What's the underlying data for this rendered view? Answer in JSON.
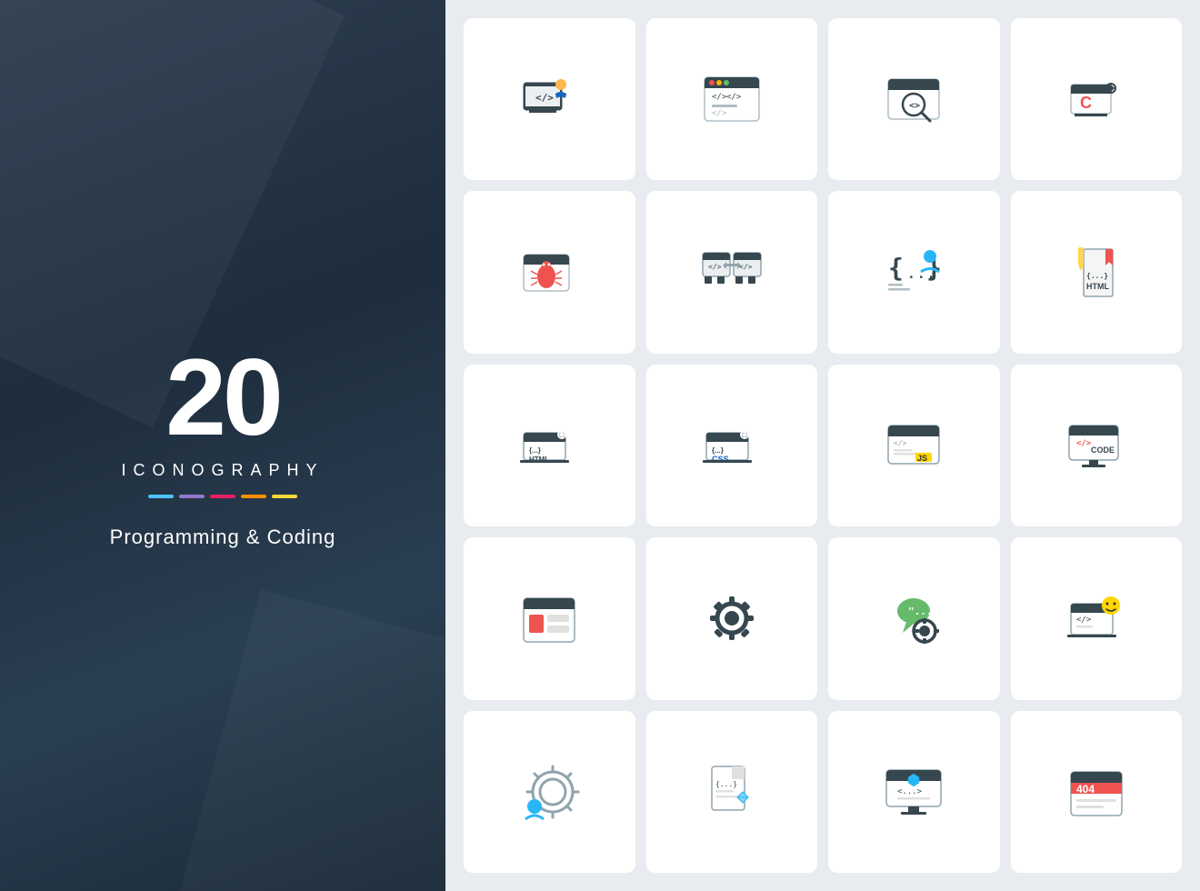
{
  "left": {
    "number": "20",
    "label": "ICONOGRAPHY",
    "subtitle": "Programming & Coding",
    "colors": [
      "#4fc3f7",
      "#9575cd",
      "#e91e63",
      "#ff8f00",
      "#fdd835"
    ]
  },
  "icons": [
    {
      "id": "coding-user",
      "label": "coding user"
    },
    {
      "id": "code-editor",
      "label": "code editor"
    },
    {
      "id": "code-search",
      "label": "code search"
    },
    {
      "id": "c-language",
      "label": "C language"
    },
    {
      "id": "bug-window",
      "label": "bug window"
    },
    {
      "id": "code-compare",
      "label": "code compare"
    },
    {
      "id": "code-user",
      "label": "code user"
    },
    {
      "id": "html-code",
      "label": "HTML code"
    },
    {
      "id": "html-settings",
      "label": "HTML settings"
    },
    {
      "id": "css-settings",
      "label": "CSS settings"
    },
    {
      "id": "js-window",
      "label": "JS window"
    },
    {
      "id": "code-monitor",
      "label": "CODE monitor"
    },
    {
      "id": "ui-layout",
      "label": "UI layout"
    },
    {
      "id": "settings-gear",
      "label": "settings gear"
    },
    {
      "id": "settings-chat",
      "label": "settings chat"
    },
    {
      "id": "code-emoji",
      "label": "code emoji"
    },
    {
      "id": "developer-settings",
      "label": "developer settings"
    },
    {
      "id": "code-file",
      "label": "code file"
    },
    {
      "id": "code-display",
      "label": "code display"
    },
    {
      "id": "404-error",
      "label": "404 error"
    }
  ]
}
